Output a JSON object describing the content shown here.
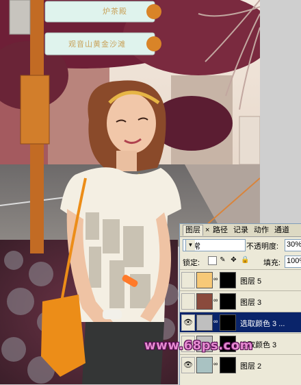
{
  "signs": [
    {
      "text": "炉茶殿"
    },
    {
      "text": "观音山黄金沙滩"
    }
  ],
  "watermark": "www.68ps.com",
  "layers_panel": {
    "tabs": [
      {
        "label": "图层",
        "active": true
      },
      {
        "label": "×",
        "active": false
      },
      {
        "label": "路径",
        "active": false
      },
      {
        "label": "记录",
        "active": false
      },
      {
        "label": "动作",
        "active": false
      },
      {
        "label": "通道",
        "active": false
      }
    ],
    "blend_mode": "正常",
    "opacity_label": "不透明度:",
    "opacity_value": "30%",
    "lock_label": "锁定:",
    "lock_icons": [
      "transparency-lock-icon",
      "brush-lock-icon",
      "move-lock-icon",
      "padlock-icon"
    ],
    "fill_label": "填充:",
    "fill_value": "100%",
    "layers": [
      {
        "name": "图层 5",
        "visible": false,
        "thumb_color": "#f7c977",
        "has_mask": true,
        "selected": false
      },
      {
        "name": "图层 3",
        "visible": false,
        "thumb_color": "#8a4a3c",
        "has_mask": true,
        "selected": false
      },
      {
        "name": "选取颜色 3 ...",
        "visible": true,
        "thumb_color": "#bfbfbf",
        "has_mask": true,
        "selected": true
      },
      {
        "name": "选取颜色 3",
        "visible": true,
        "thumb_color": "#bfbfbf",
        "has_mask": true,
        "selected": false
      },
      {
        "name": "图层 2",
        "visible": true,
        "thumb_color": "#a9c2c2",
        "has_mask": true,
        "selected": false
      }
    ]
  }
}
